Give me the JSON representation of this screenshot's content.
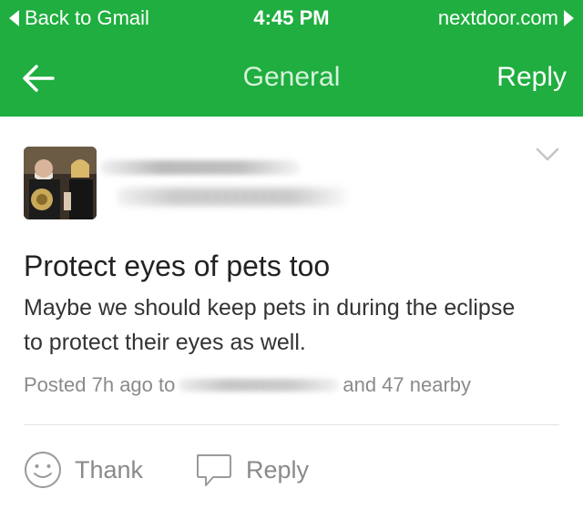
{
  "status_bar": {
    "back_label": "Back to Gmail",
    "time": "4:45 PM",
    "site": "nextdoor.com"
  },
  "nav": {
    "back_icon": "arrow-left-icon",
    "title": "General",
    "reply_label": "Reply"
  },
  "post": {
    "title": "Protect eyes of pets too",
    "body": "Maybe we should keep pets in during the eclipse to protect their eyes as well.",
    "meta_prefix": "Posted 7h ago to",
    "meta_suffix": "and 47 nearby"
  },
  "actions": {
    "thank_label": "Thank",
    "reply_label": "Reply"
  },
  "colors": {
    "header_green": "#1fae3f",
    "text_gray": "#8a8a8a"
  }
}
